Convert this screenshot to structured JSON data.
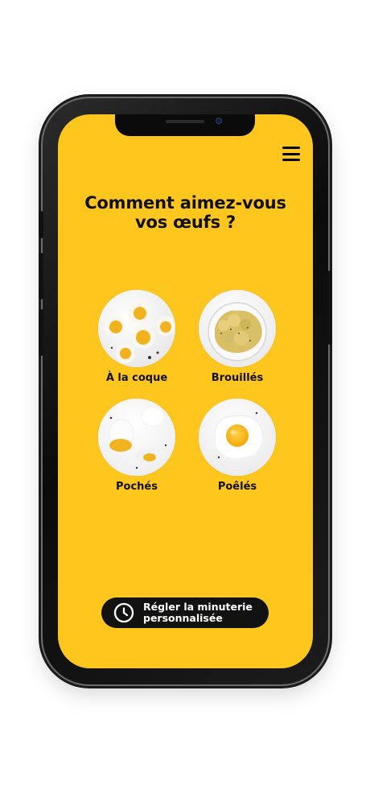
{
  "app": {
    "screen_background": "#ffc71e",
    "title": "Comment aimez-vous vos œufs ?"
  },
  "icons": {
    "menu": "hamburger-menu-icon",
    "timer": "clock-icon"
  },
  "options": [
    {
      "label": "À la coque"
    },
    {
      "label": "Brouillés"
    },
    {
      "label": "Pochés"
    },
    {
      "label": "Poêlés"
    }
  ],
  "timer_button": {
    "label": "Régler la minuterie\npersonnalisée"
  }
}
